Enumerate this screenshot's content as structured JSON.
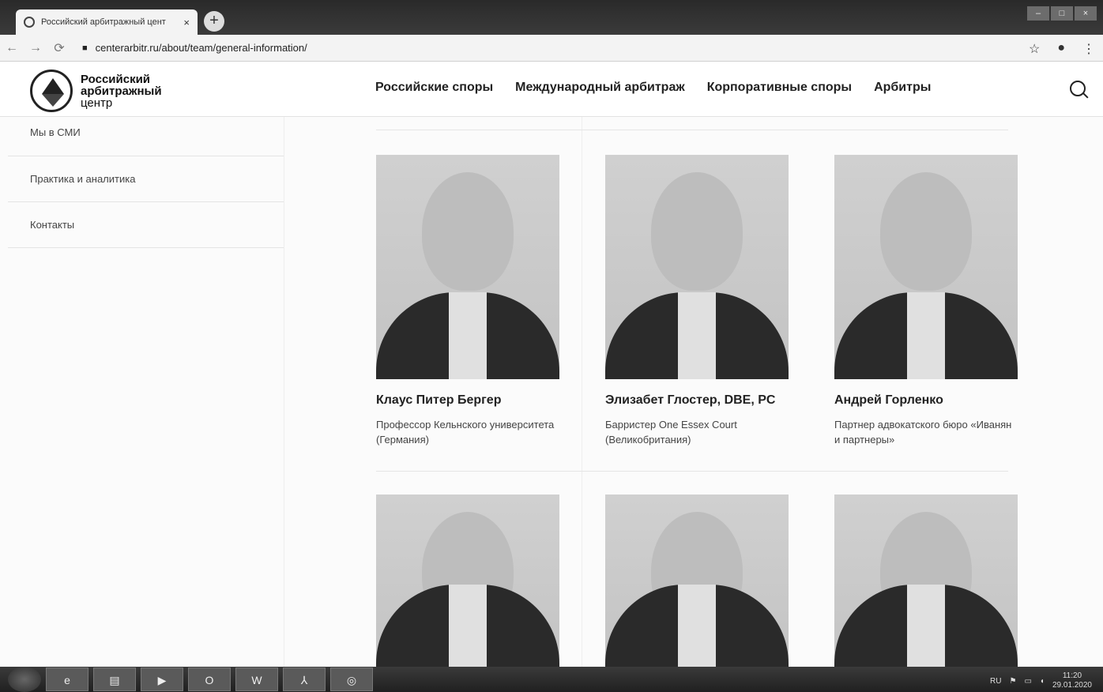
{
  "browser": {
    "tab_title": "Российский арбитражный цент",
    "tab_close": "×",
    "new_tab": "+",
    "url": "centerarbitr.ru/about/team/general-information/",
    "window_buttons": [
      "–",
      "□",
      "×"
    ]
  },
  "site": {
    "logo_line1": "Российский",
    "logo_line2": "арбитражный",
    "logo_line3": "центр",
    "nav": [
      "Российские споры",
      "Международный арбитраж",
      "Корпоративные споры",
      "Арбитры"
    ]
  },
  "sidebar": {
    "items": [
      {
        "label": "Мы в СМИ"
      },
      {
        "label": "Практика и аналитика"
      },
      {
        "label": "Контакты"
      }
    ]
  },
  "team": [
    {
      "name": "Клаус Питер Бергер",
      "role": "Профессор Кельнского университета (Германия)"
    },
    {
      "name": "Элизабет Глостер, DBE, PC",
      "role": "Барристер One Essex Court (Великобритания)"
    },
    {
      "name": "Андрей Горленко",
      "role": "Партнер адвокатского бюро «Иванян и партнеры»"
    }
  ],
  "taskbar": {
    "apps": [
      "e",
      "▤",
      "▶",
      "O",
      "W",
      "⅄",
      "◎"
    ],
    "lang": "RU",
    "time": "11:20",
    "date": "29.01.2020"
  }
}
